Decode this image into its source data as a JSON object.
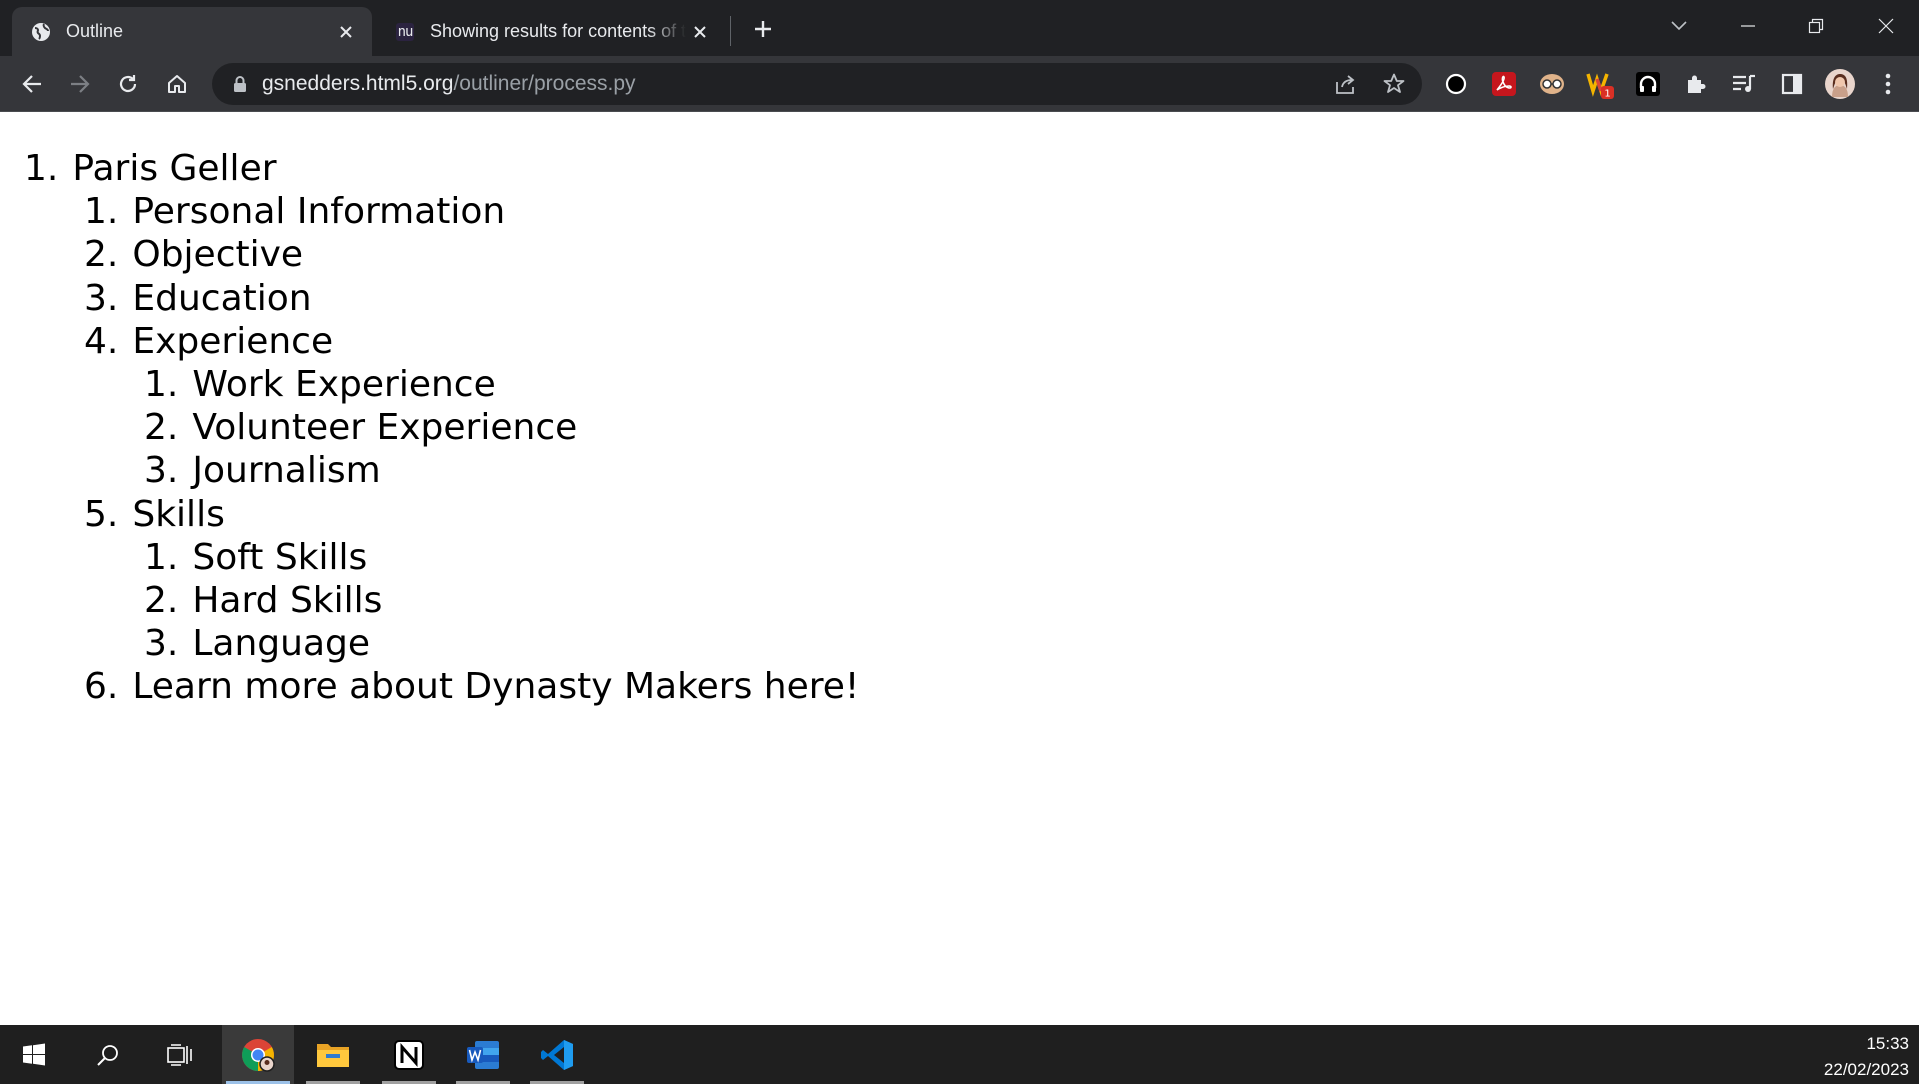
{
  "browser": {
    "tabs": [
      {
        "title": "Outline",
        "favicon": "globe-icon",
        "active": true
      },
      {
        "title": "Showing results for contents of text-field",
        "favicon_text": "nu",
        "active": false
      }
    ],
    "address_bar": {
      "host": "gsnedders.html5.org",
      "path": "/outliner/process.py"
    },
    "extension_badge": "1"
  },
  "outline": {
    "root": {
      "num": "1.",
      "label": "Paris Geller"
    },
    "sections": [
      {
        "num": "1.",
        "label": "Personal Information"
      },
      {
        "num": "2.",
        "label": "Objective"
      },
      {
        "num": "3.",
        "label": "Education"
      },
      {
        "num": "4.",
        "label": "Experience",
        "children": [
          {
            "num": "1.",
            "label": "Work Experience"
          },
          {
            "num": "2.",
            "label": "Volunteer Experience"
          },
          {
            "num": "3.",
            "label": "Journalism"
          }
        ]
      },
      {
        "num": "5.",
        "label": "Skills",
        "children": [
          {
            "num": "1.",
            "label": "Soft Skills"
          },
          {
            "num": "2.",
            "label": "Hard Skills"
          },
          {
            "num": "3.",
            "label": "Language"
          }
        ]
      },
      {
        "num": "6.",
        "label": "Learn more about Dynasty Makers here!"
      }
    ]
  },
  "taskbar": {
    "time": "15:33",
    "date": "22/02/2023",
    "apps": [
      "windows-start",
      "search",
      "task-view",
      "chrome",
      "file-explorer",
      "notion",
      "word",
      "vscode"
    ]
  },
  "colors": {
    "tabstrip": "#202124",
    "toolbar": "#35363a",
    "omnibox": "#202124",
    "taskbar": "#1f1f1f"
  }
}
